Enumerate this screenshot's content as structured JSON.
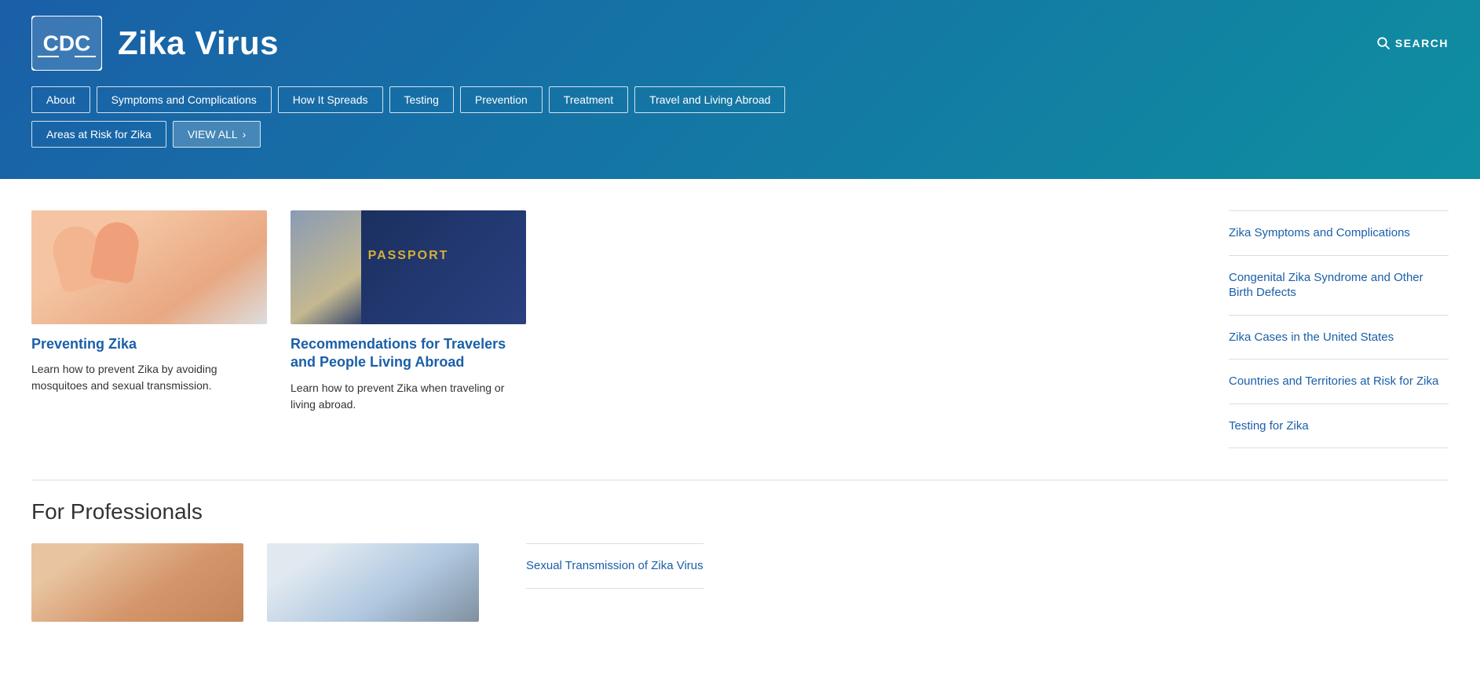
{
  "header": {
    "logo_alt": "CDC Logo",
    "site_title": "Zika Virus",
    "search_label": "SEARCH"
  },
  "nav": {
    "items": [
      {
        "id": "about",
        "label": "About"
      },
      {
        "id": "symptoms",
        "label": "Symptoms and Complications"
      },
      {
        "id": "how-it-spreads",
        "label": "How It Spreads"
      },
      {
        "id": "testing",
        "label": "Testing"
      },
      {
        "id": "prevention",
        "label": "Prevention"
      },
      {
        "id": "treatment",
        "label": "Treatment"
      },
      {
        "id": "travel",
        "label": "Travel and Living Abroad"
      }
    ],
    "extra_items": [
      {
        "id": "areas-at-risk",
        "label": "Areas at Risk for Zika"
      }
    ],
    "view_all_label": "VIEW ALL"
  },
  "cards": [
    {
      "id": "preventing-zika",
      "title": "Preventing Zika",
      "description": "Learn how to prevent Zika by avoiding mosquitoes and sexual transmission.",
      "image_type": "hands"
    },
    {
      "id": "recommendations-travelers",
      "title": "Recommendations for Travelers and People Living Abroad",
      "description": "Learn how to prevent Zika when traveling or living abroad.",
      "image_type": "passport"
    }
  ],
  "sidebar_links": [
    {
      "id": "zika-symptoms",
      "label": "Zika Symptoms and Complications"
    },
    {
      "id": "congenital-zika",
      "label": "Congenital Zika Syndrome and Other Birth Defects"
    },
    {
      "id": "zika-cases-us",
      "label": "Zika Cases in the United States"
    },
    {
      "id": "countries-risk",
      "label": "Countries and Territories at Risk for Zika"
    },
    {
      "id": "testing-zika",
      "label": "Testing for Zika"
    }
  ],
  "professionals": {
    "title": "For Professionals",
    "links": [
      {
        "id": "sexual-transmission",
        "label": "Sexual Transmission of Zika Virus"
      }
    ]
  }
}
